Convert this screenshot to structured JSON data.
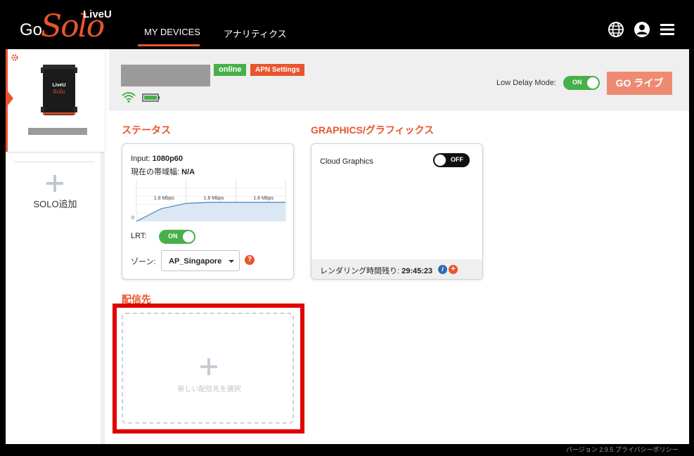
{
  "brand": {
    "go": "Go",
    "solo": "Solo",
    "liveu": "LiveU"
  },
  "nav": {
    "tab_devices": "MY DEVICES",
    "tab_analytics": "アナリティクス"
  },
  "sidebar": {
    "add_label": "SOLO追加",
    "device_logo_top": "LiveU",
    "device_logo_bottom": "Solo"
  },
  "header": {
    "status_online": "online",
    "apn_settings": "APN Settings",
    "low_delay_label": "Low Delay Mode:",
    "low_delay_toggle": "ON",
    "go_live": "GO ライブ"
  },
  "status": {
    "title": "ステータス",
    "input_label": "Input:",
    "input_value": "1080p60",
    "bandwidth_label": "現在の帯域幅:",
    "bandwidth_value": "N/A",
    "lrt_label": "LRT:",
    "lrt_toggle": "ON",
    "zone_label": "ゾーン:",
    "zone_value": "AP_Singapore",
    "zone_help": "?"
  },
  "chart_data": {
    "type": "area",
    "title": "",
    "xlabel": "",
    "ylabel": "",
    "y_tick_label": "0",
    "data_labels": [
      "1.8 Mbps",
      "1.8 Mbps",
      "1.8 Mbps"
    ],
    "series": [
      {
        "values": [
          0,
          1.2,
          1.7,
          1.8,
          1.8,
          1.8,
          1.8
        ]
      }
    ],
    "ylim": [
      0,
      4
    ],
    "grid": true,
    "color": "#5b93c8"
  },
  "graphics": {
    "title": "GRAPHICS/グラフィックス",
    "cloud_label": "Cloud Graphics",
    "cloud_toggle": "OFF",
    "render_label": "レンダリング時間残り:",
    "render_value": "29:45:23",
    "info_glyph": "i",
    "add_glyph": "+"
  },
  "destination": {
    "title": "配信先",
    "select_label": "新しい配信先を選択"
  },
  "footer": {
    "text": "バージョン 2.9.5  プライバシーポリシー"
  },
  "colors": {
    "accent": "#e8552d",
    "online": "#46b04a",
    "go_live": "#ef8a72",
    "highlight": "#e00000"
  }
}
